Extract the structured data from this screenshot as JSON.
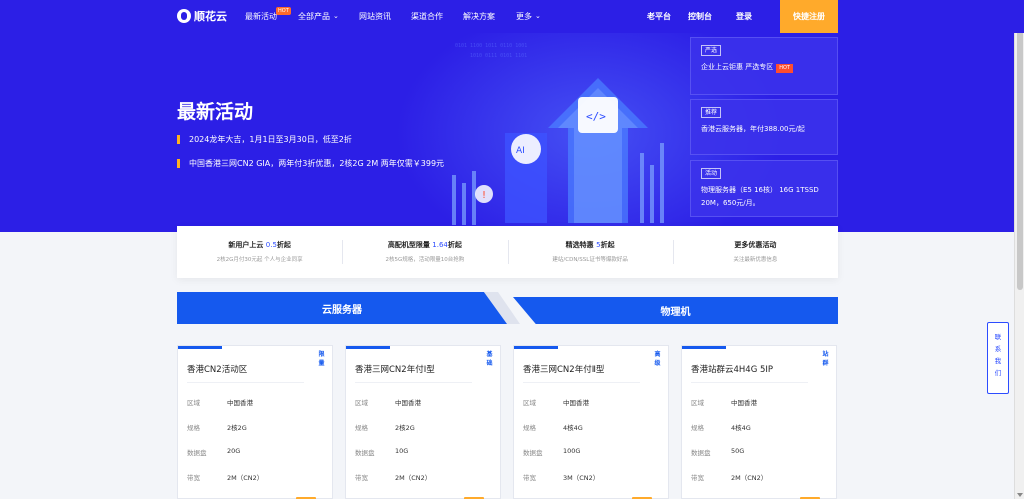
{
  "header": {
    "logo_text": "顺花云",
    "nav": {
      "activities": "最新活动",
      "hot_badge": "HOT",
      "products": "全部产品",
      "news": "网站资讯",
      "partners": "渠道合作",
      "solutions": "解决方案",
      "more": "更多"
    },
    "old_platform": "老平台",
    "console": "控制台",
    "login": "登录",
    "register": "快捷注册"
  },
  "hero": {
    "title": "最新活动",
    "lines": [
      "2024龙年大吉，1月1日至3月30日，低至2折",
      "中国香港三网CN2 GIA，两年付3折优惠，2核2G 2M 两年仅需￥399元"
    ],
    "cards": [
      {
        "tag": "严选",
        "text": "企业上云钜惠 严选专区",
        "hot": "HOT"
      },
      {
        "tag": "推荐",
        "text": "香港云服务器，年付388.00元/起"
      },
      {
        "tag": "活动",
        "text": "物理服务器（E5 16核） 16G 1TSSD 20M，650元/月。"
      }
    ]
  },
  "features": [
    {
      "title": "新用户上云",
      "highlight": "0.5",
      "suffix": "折起",
      "sub": "2核2G月付30元起 个人与企业同享"
    },
    {
      "title": "高配机型限量",
      "highlight": "1.64",
      "suffix": "折起",
      "sub": "2核5G规格，活动限量10台抢购"
    },
    {
      "title": "精选特惠",
      "highlight": "5",
      "suffix": "折起",
      "sub": "建站/CDN/SSL证书等爆款好品"
    },
    {
      "title": "更多优惠活动",
      "highlight": "",
      "suffix": "",
      "sub": "关注最新优惠信息"
    }
  ],
  "tabs": {
    "cloud": "云服务器",
    "physical": "物理机"
  },
  "spec_labels": {
    "region": "区域",
    "spec": "规格",
    "disk": "数据盘",
    "bandwidth": "带宽"
  },
  "products": [
    {
      "tag": "限量",
      "title": "香港CN2活动区",
      "region": "中国香港",
      "spec": "2核2G",
      "disk": "20G",
      "bandwidth": "2M（CN2）"
    },
    {
      "tag": "基础",
      "title": "香港三网CN2年付Ⅰ型",
      "region": "中国香港",
      "spec": "2核2G",
      "disk": "10G",
      "bandwidth": "2M（CN2）"
    },
    {
      "tag": "高级",
      "title": "香港三网CN2年付Ⅱ型",
      "region": "中国香港",
      "spec": "4核4G",
      "disk": "100G",
      "bandwidth": "3M（CN2）"
    },
    {
      "tag": "站群",
      "title": "香港站群云4H4G 5IP",
      "region": "中国香港",
      "spec": "4核4G",
      "disk": "50G",
      "bandwidth": "2M（CN2）"
    }
  ],
  "side_contact": "联系我们",
  "colors": {
    "primary": "#2c1fe6",
    "tab_blue": "#1559ee",
    "accent_orange": "#ffaa2b",
    "hot_red": "#ff4d2e"
  }
}
